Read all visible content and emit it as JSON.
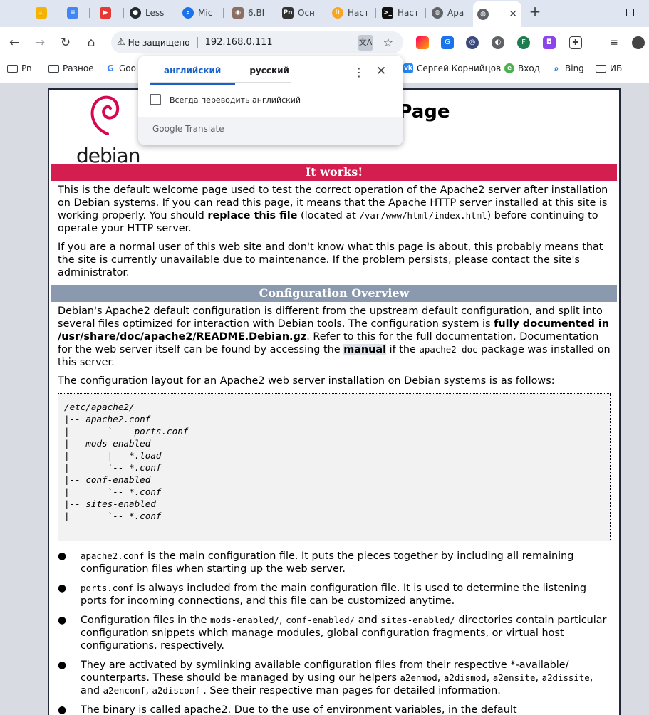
{
  "tabs": [
    {
      "label": "",
      "icon": "folder-icon",
      "color": "#f4b400"
    },
    {
      "label": "",
      "icon": "docs-icon",
      "color": "#4285f4"
    },
    {
      "label": "",
      "icon": "youtube-icon",
      "color": "#e53935"
    },
    {
      "label": "Less",
      "icon": "github-icon",
      "color": "#24292e"
    },
    {
      "label": "Mic",
      "icon": "search-icon",
      "color": "#1a73e8"
    },
    {
      "label": "6.ВІ",
      "icon": "owl-icon",
      "color": "#8d6e63"
    },
    {
      "label": "Осн",
      "icon": "pn-icon",
      "color": "#333333"
    },
    {
      "label": "Наст",
      "icon": "lt-icon",
      "color": "#f6a623"
    },
    {
      "label": "Наст",
      "icon": "terminal-icon",
      "color": "#111111"
    },
    {
      "label": "Apa",
      "icon": "globe-icon",
      "color": "#5f6368"
    },
    {
      "label": "",
      "icon": "globe-icon",
      "color": "#5f6368",
      "active": true
    }
  ],
  "toolbar": {
    "security_label": "Не защищено",
    "url": "192.168.0.111"
  },
  "bookmarks": {
    "items": [
      "Pn",
      "Разное",
      "Goo",
      "Сергей Корнийцов",
      "Вход",
      "Bing",
      "ИБ"
    ]
  },
  "translate_popup": {
    "tab_source": "английский",
    "tab_target": "русский",
    "always_translate_label": "Всегда переводить английский",
    "brand": "Google Translate"
  },
  "page": {
    "logo_text": "debian",
    "title_visible": "lt Page",
    "banner_it_works": "It works!",
    "intro_p1_a": "This is the default welcome page used to test the correct operation of the Apache2 server after installation on Debian systems. If you can read this page, it means that the Apache HTTP server installed at this site is working properly. You should ",
    "intro_p1_bold": "replace this file",
    "intro_p1_b": " (located at ",
    "intro_p1_code": "/var/www/html/index.html",
    "intro_p1_c": ") before continuing to operate your HTTP server.",
    "intro_p2": "If you are a normal user of this web site and don't know what this page is about, this probably means that the site is currently unavailable due to maintenance. If the problem persists, please contact the site's administrator.",
    "banner_config": "Configuration Overview",
    "config_p1_a": "Debian's Apache2 default configuration is different from the upstream default configuration, and split into several files optimized for interaction with Debian tools. The configuration system is ",
    "config_p1_bold": "fully documented in /usr/share/doc/apache2/README.Debian.gz",
    "config_p1_b": ". Refer to this for the full documentation. Documentation for the web server itself can be found by accessing the ",
    "config_p1_manual": "manual",
    "config_p1_c": " if the ",
    "config_p1_code": "apache2-doc",
    "config_p1_d": " package was installed on this server.",
    "config_p2": "The configuration layout for an Apache2 web server installation on Debian systems is as follows:",
    "config_tree": "/etc/apache2/\n|-- apache2.conf\n|       `--  ports.conf\n|-- mods-enabled\n|       |-- *.load\n|       `-- *.conf\n|-- conf-enabled\n|       `-- *.conf\n|-- sites-enabled\n|       `-- *.conf",
    "bullet1_code": "apache2.conf",
    "bullet1_text": " is the main configuration file. It puts the pieces together by including all remaining configuration files when starting up the web server.",
    "bullet2_code": "ports.conf",
    "bullet2_text": " is always included from the main configuration file. It is used to determine the listening ports for incoming connections, and this file can be customized anytime.",
    "bullet3_a": "Configuration files in the ",
    "bullet3_code1": "mods-enabled/",
    "bullet3_b": ", ",
    "bullet3_code2": "conf-enabled/",
    "bullet3_c": " and ",
    "bullet3_code3": "sites-enabled/",
    "bullet3_d": " directories contain particular configuration snippets which manage modules, global configuration fragments, or virtual host configurations, respectively.",
    "bullet4_a": "They are activated by symlinking available configuration files from their respective *-available/ counterparts. These should be managed by using our helpers ",
    "bullet4_code1": "a2enmod",
    "bullet4_code2": "a2dismod",
    "bullet4_code3": "a2ensite",
    "bullet4_code4": "a2dissite",
    "bullet4_code5": "a2enconf",
    "bullet4_code6": "a2disconf",
    "bullet4_b": " . See their respective man pages for detailed information.",
    "bullet5_a": "The binary is called apache2. Due to the use of environment variables, in the default"
  }
}
